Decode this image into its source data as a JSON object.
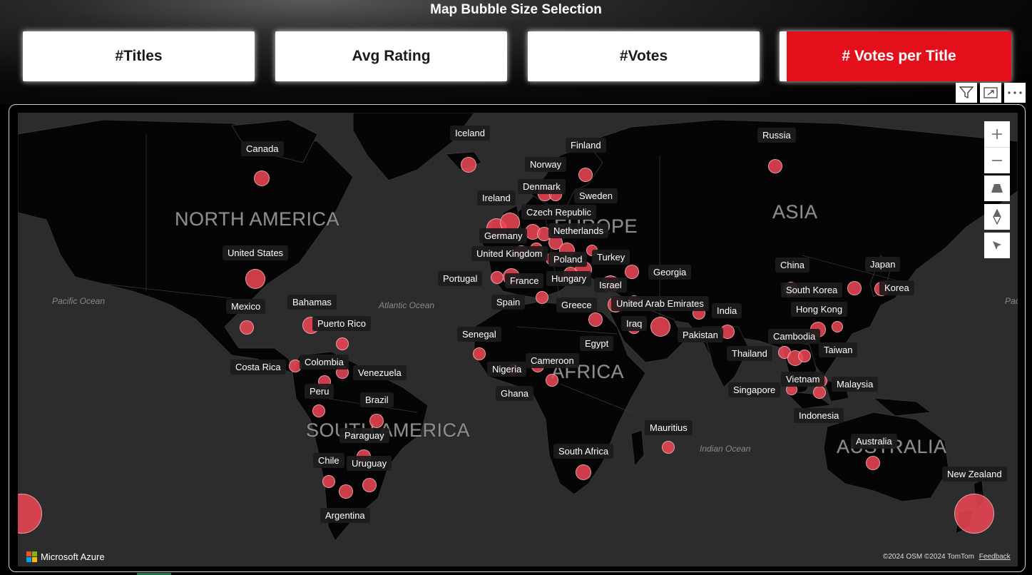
{
  "header": {
    "title": "Map Bubble Size Selection",
    "buttons": [
      {
        "label": "#Titles",
        "selected": false
      },
      {
        "label": "Avg Rating",
        "selected": false
      },
      {
        "label": "#Votes",
        "selected": false
      },
      {
        "label": "# Votes per Title",
        "selected": true
      }
    ]
  },
  "visual_header_icons": [
    "filter-icon",
    "focus-mode-icon",
    "more-options-icon"
  ],
  "map": {
    "continents": [
      "NORTH AMERICA",
      "EUROPE",
      "ASIA",
      "AFRICA",
      "SOUTH AMERICA",
      "AUSTRALIA"
    ],
    "oceans": [
      "Pacific Ocean",
      "Atlantic Ocean",
      "Indian Ocean",
      "Pac"
    ],
    "countries": [
      "Canada",
      "Iceland",
      "Finland",
      "Russia",
      "Norway",
      "Denmark",
      "Sweden",
      "Ireland",
      "Czech Republic",
      "Germany",
      "Netherlands",
      "United Kingdom",
      "Poland",
      "Turkey",
      "United States",
      "Portugal",
      "France",
      "Hungary",
      "Georgia",
      "China",
      "Japan",
      "Israel",
      "South Korea",
      "Korea",
      "Mexico",
      "Bahamas",
      "Spain",
      "Greece",
      "United Arab Emirates",
      "India",
      "Hong Kong",
      "Puerto Rico",
      "Iraq",
      "Pakistan",
      "Senegal",
      "Egypt",
      "Cambodia",
      "Taiwan",
      "Thailand",
      "Costa Rica",
      "Colombia",
      "Venezuela",
      "Cameroon",
      "Nigeria",
      "Vietnam",
      "Malaysia",
      "Peru",
      "Ghana",
      "Singapore",
      "Brazil",
      "Indonesia",
      "Mauritius",
      "Paraguay",
      "Australia",
      "Chile",
      "South Africa",
      "Uruguay",
      "New Zealand",
      "Argentina"
    ],
    "bubble_color": "#f04656",
    "controls": [
      "zoom-in-icon",
      "zoom-out-icon",
      "pitch-icon",
      "compass-icon",
      "select-icon"
    ],
    "logo_text": "Microsoft Azure",
    "attribution": "©2024 OSM  ©2024 TomTom",
    "feedback_label": "Feedback"
  },
  "colors": {
    "accent": "#e3101b",
    "map_background": "#2c2c2c",
    "land": "#050505"
  }
}
